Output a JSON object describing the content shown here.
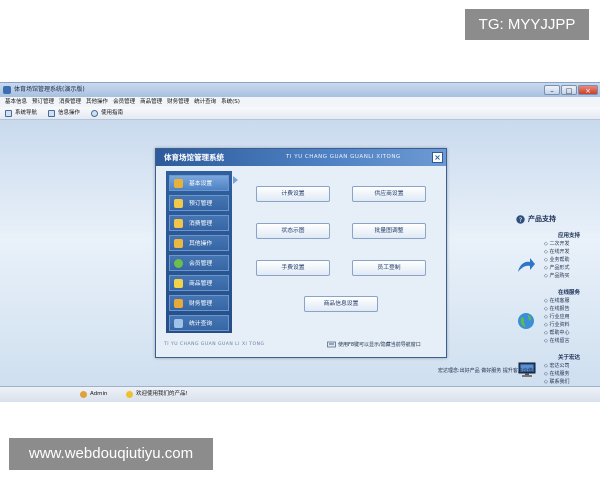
{
  "watermark_top": "TG: MYYJJPP",
  "watermark_bottom": "www.webdouqiutiyu.com",
  "window": {
    "title": "体育场馆管理系统(演示版)",
    "controls": {
      "minimize": "–",
      "maximize": "□",
      "close": "×"
    }
  },
  "menubar": [
    "基本信息",
    "预订管理",
    "消费管理",
    "其他操作",
    "会员管理",
    "商品管理",
    "财务管理",
    "统计查询",
    "系统(S)"
  ],
  "toolbar": [
    {
      "label": "系统导航"
    },
    {
      "label": "信息操作"
    },
    {
      "label": "使用指南"
    }
  ],
  "dialog": {
    "title": "体育场馆管理系统",
    "title_en": "TI YU CHANG GUAN GUANLI XITONG",
    "close": "×",
    "nav": [
      {
        "label": "基本设置",
        "active": true
      },
      {
        "label": "预订管理"
      },
      {
        "label": "消费管理"
      },
      {
        "label": "其他操作"
      },
      {
        "label": "会员管理"
      },
      {
        "label": "商品管理"
      },
      {
        "label": "财务管理"
      },
      {
        "label": "统计查询"
      }
    ],
    "buttons": [
      "计费设置",
      "供应商设置",
      "状态示图",
      "批量图调整",
      "手费设置",
      "员工登制",
      "商品信息设置"
    ],
    "footer_en": "TI YU CHANG GUAN GUAN LI XI TONG",
    "footer_hint": "使用F8键可以显示/隐藏当前导航窗口"
  },
  "support": {
    "title": "产品支持",
    "sections": [
      {
        "title": "应用支持",
        "links": [
          "二次开发",
          "在线开发",
          "业务帮助",
          "产品形式",
          "产品购买"
        ]
      },
      {
        "title": "在线服务",
        "links": [
          "在线客服",
          "在线报告",
          "行业应用",
          "行业资料",
          "帮助中心",
          "在线留言"
        ]
      },
      {
        "title": "关于宏达",
        "links": [
          "宏达公司",
          "在线服务",
          "联系我们"
        ]
      }
    ]
  },
  "slogan": "宏达理念:出好产品  做好服务  提升客户价值!",
  "status": {
    "user": "Admin",
    "welcome": "欢迎使用我们的产品!"
  }
}
